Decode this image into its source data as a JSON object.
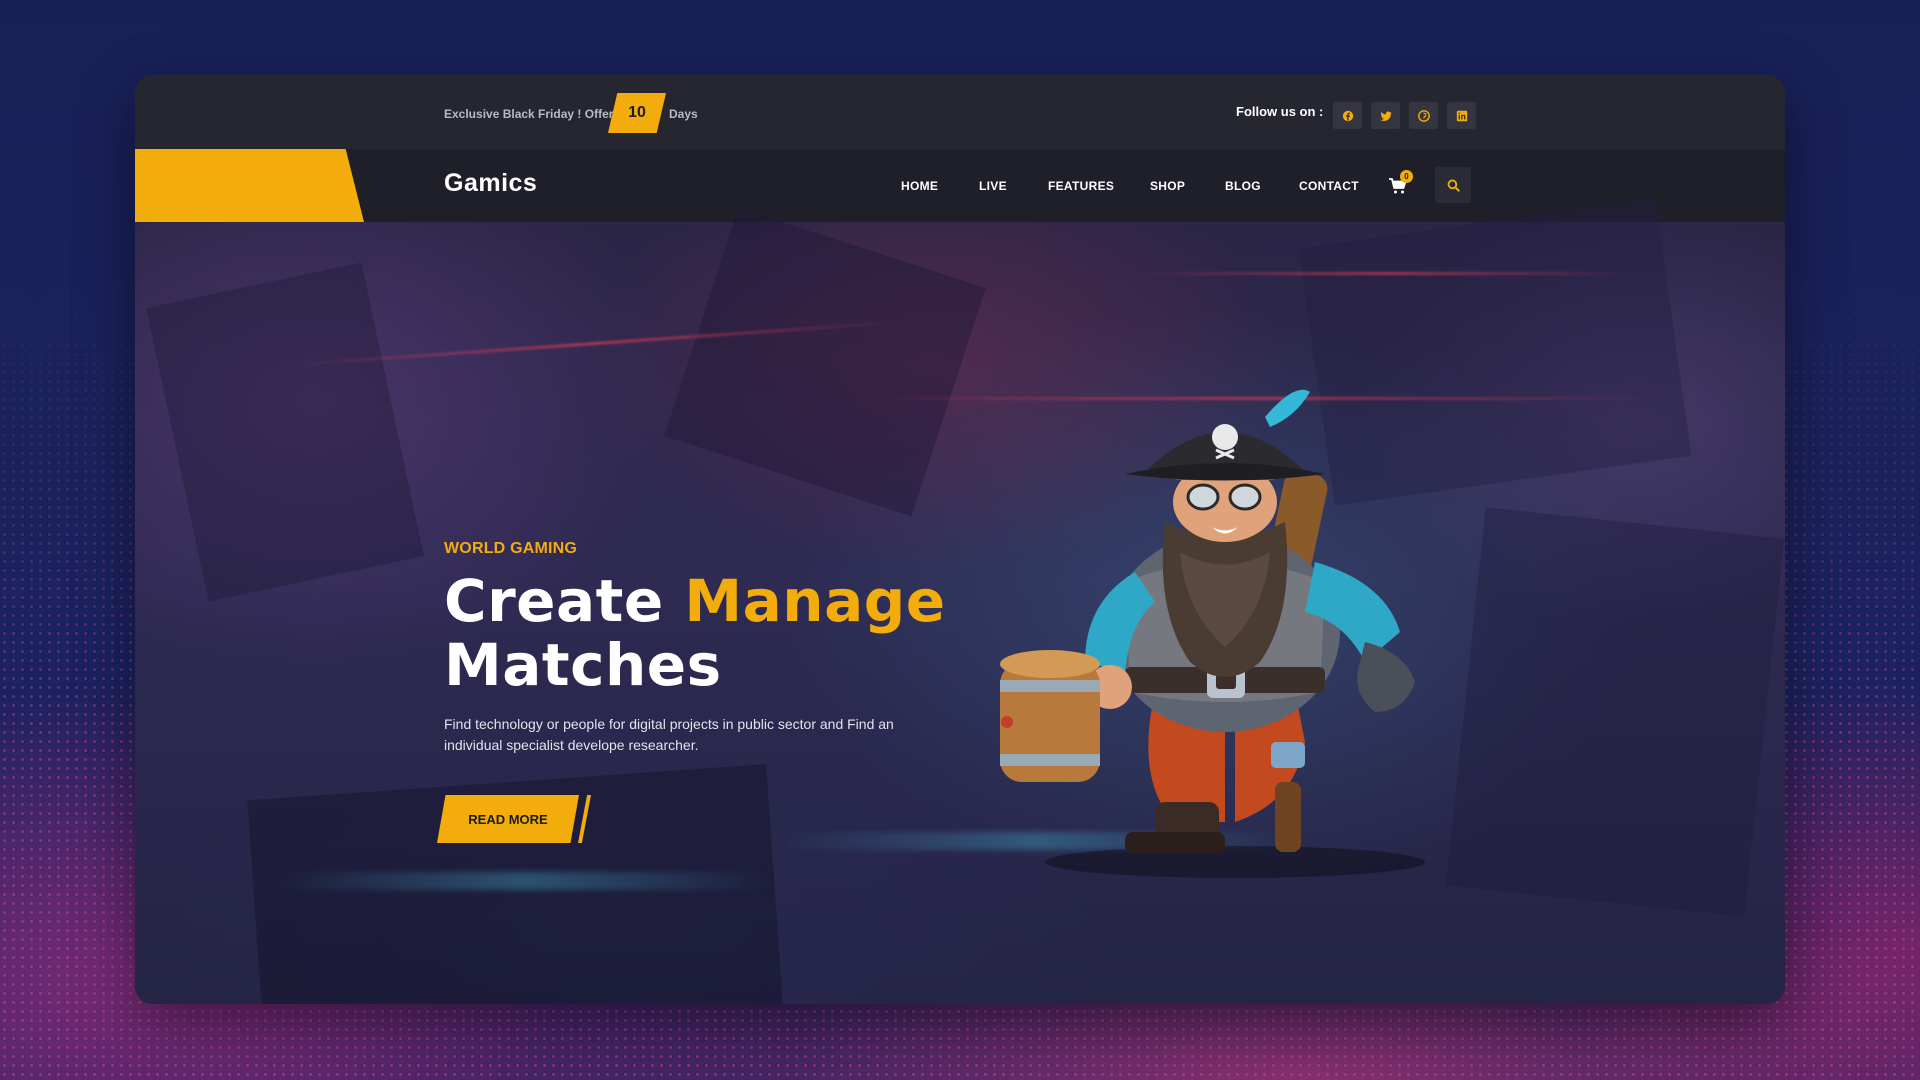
{
  "topbar": {
    "offer_text": "Exclusive Black Friday ! Offer",
    "offer_count": "10",
    "offer_unit": "Days",
    "follow_label": "Follow us on :",
    "social": [
      {
        "icon": "facebook-icon"
      },
      {
        "icon": "twitter-icon"
      },
      {
        "icon": "pinterest-icon"
      },
      {
        "icon": "linkedin-icon"
      }
    ]
  },
  "nav": {
    "logo": "Gamics",
    "items": [
      {
        "label": "HOME"
      },
      {
        "label": "LIVE"
      },
      {
        "label": "FEATURES"
      },
      {
        "label": "SHOP"
      },
      {
        "label": "BLOG"
      },
      {
        "label": "CONTACT"
      }
    ],
    "cart_count": "0",
    "cart_icon": "cart-icon",
    "search_icon": "search-icon"
  },
  "hero": {
    "kicker": "WORLD GAMING",
    "headline_part1": "Create",
    "headline_accent": "Manage",
    "headline_part2": "Matches",
    "description": "Find technology or people for digital projects in public sector and Find an individual specialist develope researcher.",
    "button_label": "READ MORE",
    "image": "pirate-character"
  },
  "colors": {
    "accent": "#f2ac0b",
    "page_bg": "#182157",
    "topbar_bg": "#25262f",
    "navbar_bg": "#1e1f28"
  }
}
